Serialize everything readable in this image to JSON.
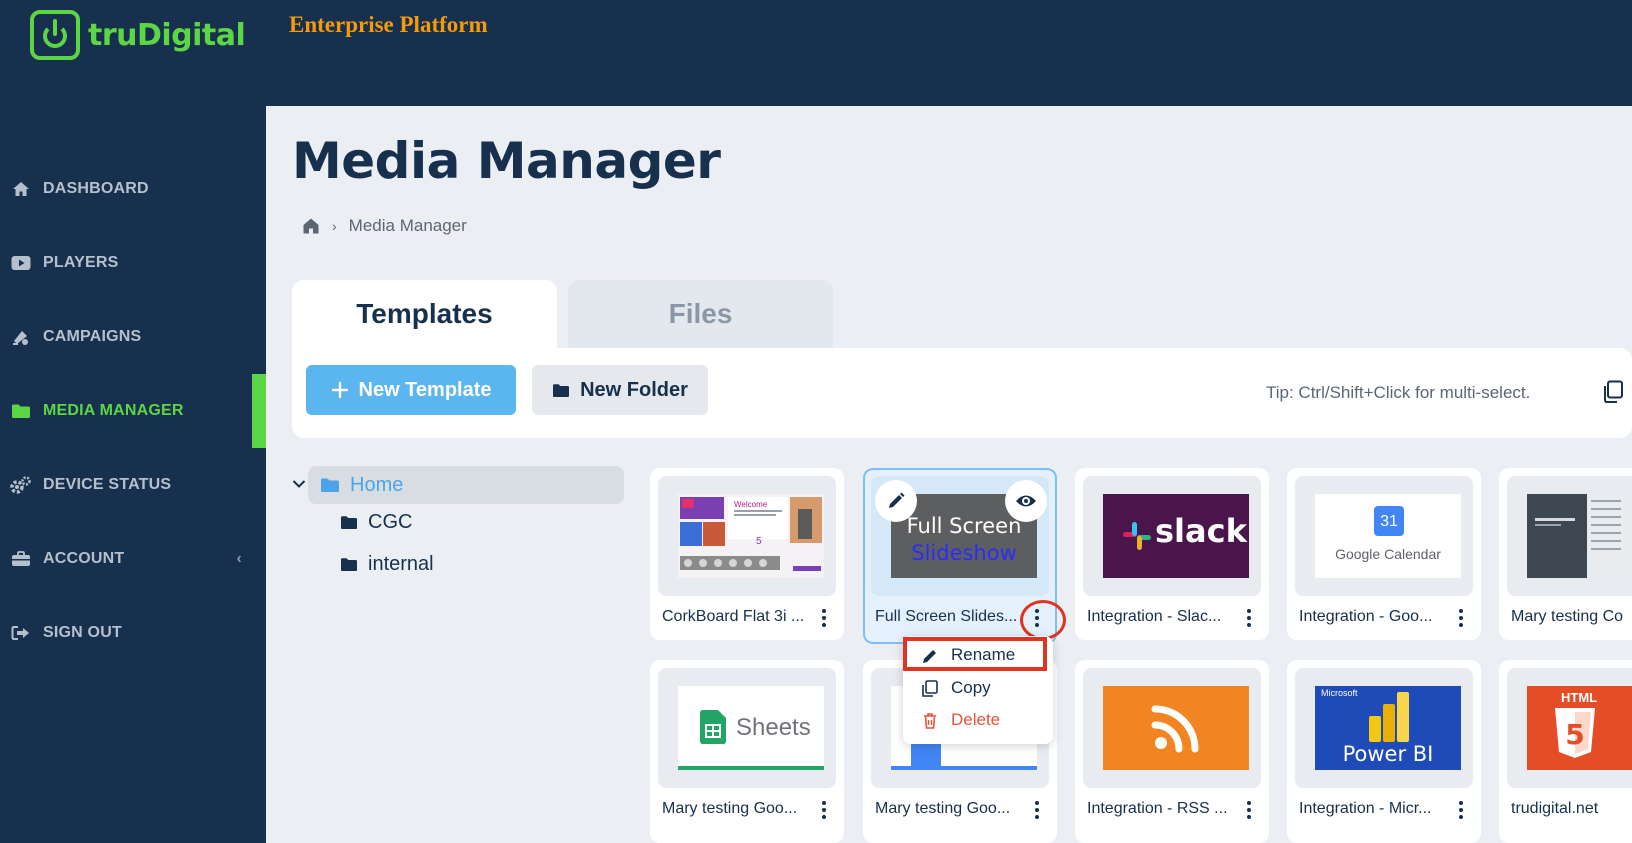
{
  "brand": {
    "name": "truDigital",
    "platform": "Enterprise Platform",
    "accent": "#5cd645",
    "platform_color": "#f59a0b"
  },
  "sidebar": {
    "items": [
      {
        "label": "DASHBOARD",
        "icon": "home-icon"
      },
      {
        "label": "PLAYERS",
        "icon": "play-icon"
      },
      {
        "label": "CAMPAIGNS",
        "icon": "campaign-icon"
      },
      {
        "label": "MEDIA MANAGER",
        "icon": "folder-icon",
        "active": true
      },
      {
        "label": "DEVICE STATUS",
        "icon": "cogs-icon"
      },
      {
        "label": "ACCOUNT",
        "icon": "briefcase-icon",
        "expand": "‹"
      },
      {
        "label": "SIGN OUT",
        "icon": "sign-out-icon"
      }
    ]
  },
  "main": {
    "title": "Media Manager",
    "breadcrumb": {
      "current": "Media Manager"
    },
    "tabs": [
      {
        "label": "Templates",
        "active": true
      },
      {
        "label": "Files",
        "active": false
      }
    ],
    "toolbar": {
      "new_template": "New Template",
      "new_folder": "New Folder",
      "tip": "Tip: Ctrl/Shift+Click for multi-select."
    },
    "tree": {
      "root": "Home",
      "children": [
        "CGC",
        "internal"
      ]
    },
    "cards": [
      {
        "label": "CorkBoard Flat 3i ...",
        "thumb": "corkboard"
      },
      {
        "label": "Full Screen Slides...",
        "thumb": "slideshow",
        "selected": true,
        "thumb_line1": "Full Screen",
        "thumb_line2": "Slideshow"
      },
      {
        "label": "Integration - Slac...",
        "thumb": "slack",
        "thumb_text": "slack"
      },
      {
        "label": "Integration - Goo...",
        "thumb": "google-calendar",
        "thumb_text": "Google Calendar",
        "thumb_day": "31"
      },
      {
        "label": "Mary testing Co",
        "thumb": "calendar-list"
      },
      {
        "label": "Mary testing Goo...",
        "thumb": "sheets",
        "thumb_text": "Sheets"
      },
      {
        "label": "Mary testing Goo...",
        "thumb": "google-blue"
      },
      {
        "label": "Integration - RSS ...",
        "thumb": "rss"
      },
      {
        "label": "Integration - Micr...",
        "thumb": "power-bi",
        "thumb_text": "Power BI",
        "thumb_sub": "Microsoft"
      },
      {
        "label": "trudigital.net",
        "thumb": "html5",
        "thumb_text": "HTML"
      }
    ],
    "context_menu": {
      "rename": "Rename",
      "copy": "Copy",
      "delete": "Delete"
    }
  }
}
